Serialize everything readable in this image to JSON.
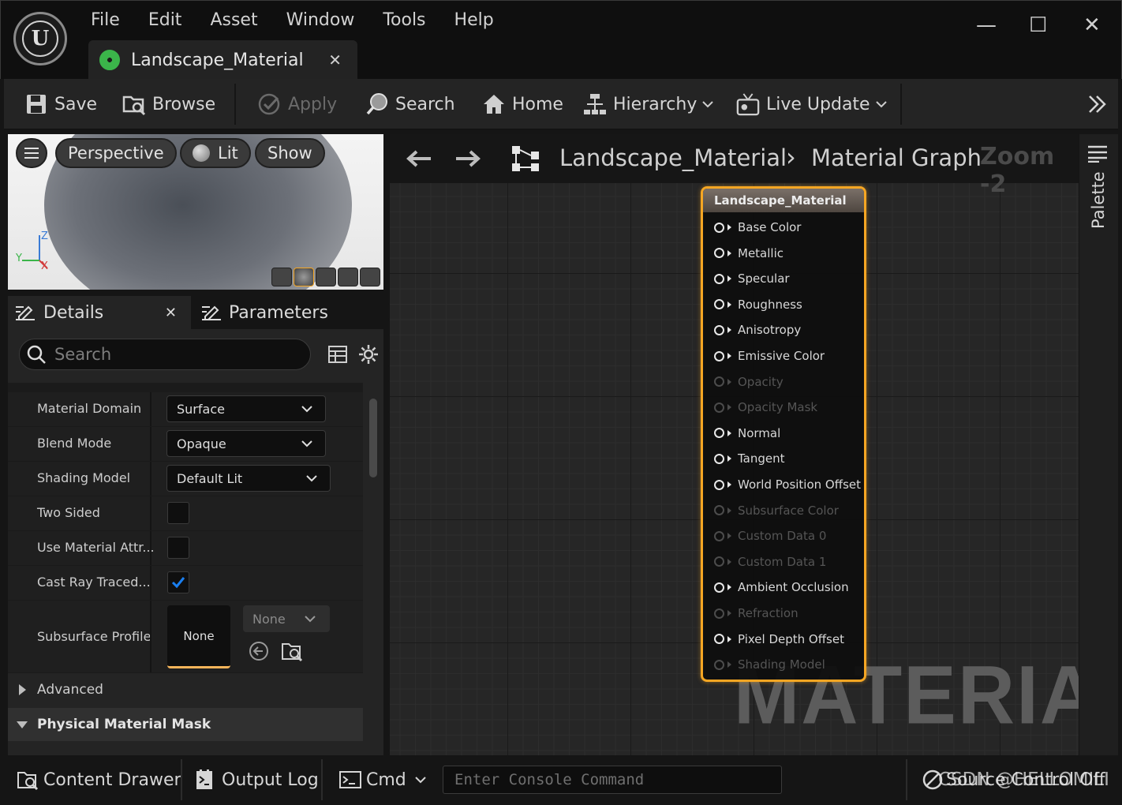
{
  "app": {
    "menu": [
      "File",
      "Edit",
      "Asset",
      "Window",
      "Tools",
      "Help"
    ],
    "document_tab": "Landscape_Material",
    "window_controls": {
      "minimize": "—",
      "maximize": "☐",
      "close": "✕"
    }
  },
  "toolbar": {
    "save": "Save",
    "browse": "Browse",
    "apply": "Apply",
    "search": "Search",
    "home": "Home",
    "hierarchy": "Hierarchy",
    "live_update": "Live Update"
  },
  "viewport": {
    "perspective": "Perspective",
    "lit": "Lit",
    "show": "Show",
    "axis_z": "Z",
    "axis_y": "Y",
    "axis_x": "X"
  },
  "panels": {
    "details": "Details",
    "parameters": "Parameters",
    "search_placeholder": "Search"
  },
  "details": {
    "rows": [
      {
        "name": "Material Domain",
        "value": "Surface"
      },
      {
        "name": "Blend Mode",
        "value": "Opaque"
      },
      {
        "name": "Shading Model",
        "value": "Default Lit"
      }
    ],
    "checks": [
      {
        "name": "Two Sided",
        "checked": false
      },
      {
        "name": "Use Material Attr...",
        "checked": false
      },
      {
        "name": "Cast Ray Traced...",
        "checked": true
      }
    ],
    "subsurface": {
      "name": "Subsurface Profile",
      "thumb": "None",
      "combo": "None"
    },
    "advanced": "Advanced",
    "physical_mask": "Physical Material Mask"
  },
  "graph": {
    "breadcrumb_root": "Landscape_Material",
    "breadcrumb_sep": "›",
    "breadcrumb_leaf": "Material Graph",
    "zoom": "Zoom -2",
    "watermark": "MATERIAL",
    "node": {
      "title": "Landscape_Material",
      "pins": [
        {
          "label": "Base Color",
          "enabled": true
        },
        {
          "label": "Metallic",
          "enabled": true
        },
        {
          "label": "Specular",
          "enabled": true
        },
        {
          "label": "Roughness",
          "enabled": true
        },
        {
          "label": "Anisotropy",
          "enabled": true
        },
        {
          "label": "Emissive Color",
          "enabled": true
        },
        {
          "label": "Opacity",
          "enabled": false
        },
        {
          "label": "Opacity Mask",
          "enabled": false
        },
        {
          "label": "Normal",
          "enabled": true
        },
        {
          "label": "Tangent",
          "enabled": true
        },
        {
          "label": "World Position Offset",
          "enabled": true
        },
        {
          "label": "Subsurface Color",
          "enabled": false
        },
        {
          "label": "Custom Data 0",
          "enabled": false
        },
        {
          "label": "Custom Data 1",
          "enabled": false
        },
        {
          "label": "Ambient Occlusion",
          "enabled": true
        },
        {
          "label": "Refraction",
          "enabled": false
        },
        {
          "label": "Pixel Depth Offset",
          "enabled": true
        },
        {
          "label": "Shading Model",
          "enabled": false
        }
      ]
    }
  },
  "palette": "Palette",
  "statusbar": {
    "content_drawer": "Content Drawer",
    "output_log": "Output Log",
    "cmd": "Cmd",
    "console_placeholder": "Enter Console Command",
    "source_control": "Source Control Off",
    "watermark_text": "CSDN @HELLOMILI"
  },
  "colors": {
    "accent_orange": "#f5a623",
    "check_blue": "#1a7ff0",
    "tab_green": "#3bb54a"
  }
}
